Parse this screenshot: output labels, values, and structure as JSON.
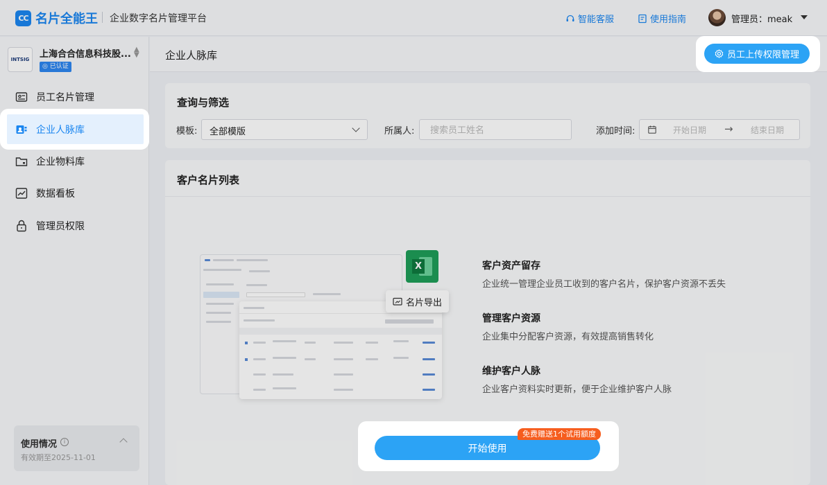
{
  "header": {
    "logo_mark": "CC",
    "brand": "名片全能王",
    "platform": "企业数字名片管理平台",
    "service_link": "智能客服",
    "guide_link": "使用指南",
    "admin_label": "管理员：meak"
  },
  "sidebar": {
    "company_name": "上海合合信息科技股...",
    "company_logo_text": "INTSIG",
    "verified": "已认证",
    "items": [
      {
        "label": "员工名片管理",
        "icon": "id-card-icon"
      },
      {
        "label": "企业人脉库",
        "icon": "contacts-icon",
        "active": true
      },
      {
        "label": "企业物料库",
        "icon": "folder-icon"
      },
      {
        "label": "数据看板",
        "icon": "chart-icon"
      },
      {
        "label": "管理员权限",
        "icon": "lock-icon"
      }
    ],
    "usage": {
      "title": "使用情况",
      "expiry": "有效期至2025-11-01"
    }
  },
  "main": {
    "page_title": "企业人脉库",
    "permission_button": "员工上传权限管理",
    "filter": {
      "title": "查询与筛选",
      "template_label": "模板:",
      "template_value": "全部模版",
      "owner_label": "所属人:",
      "owner_placeholder": "搜索员工姓名",
      "date_label": "添加时间:",
      "date_start_placeholder": "开始日期",
      "date_end_placeholder": "结束日期",
      "date_arrow": "→"
    },
    "list": {
      "title": "客户名片列表",
      "export_label": "名片导出",
      "features": [
        {
          "title": "客户资产留存",
          "desc": "企业统一管理企业员工收到的客户名片，保护客户资源不丢失"
        },
        {
          "title": "管理客户资源",
          "desc": "企业集中分配客户资源，有效提高销售转化"
        },
        {
          "title": "维护客户人脉",
          "desc": "企业客户资料实时更新，便于企业维护客户人脉"
        }
      ]
    },
    "start_button": "开始使用",
    "trial_badge": "免费赠送1个试用额度"
  },
  "colors": {
    "accent": "#1b86f0",
    "button": "#2ca3f5",
    "badge": "#f65d1e",
    "excel_green": "#1f9e58"
  }
}
